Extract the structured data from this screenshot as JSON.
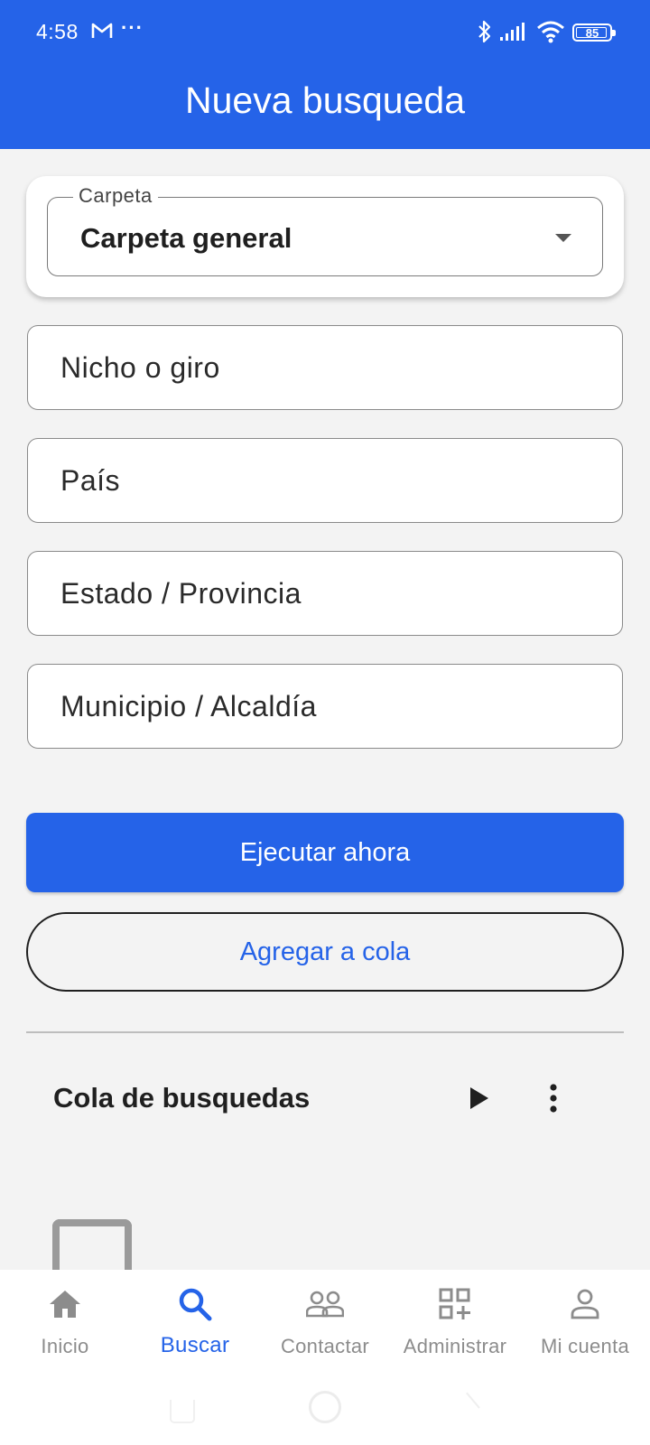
{
  "status_bar": {
    "time": "4:58",
    "battery": "85"
  },
  "header": {
    "title": "Nueva busqueda"
  },
  "colors": {
    "primary": "#2563e8",
    "background": "#f3f3f3"
  },
  "folder_select": {
    "label": "Carpeta",
    "value": "Carpeta general"
  },
  "fields": {
    "niche": {
      "placeholder": "Nicho o giro"
    },
    "country": {
      "placeholder": "País"
    },
    "state": {
      "placeholder": "Estado / Provincia"
    },
    "municipality": {
      "placeholder": "Municipio / Alcaldía"
    }
  },
  "actions": {
    "run_now": "Ejecutar ahora",
    "add_to_queue": "Agregar a cola"
  },
  "queue": {
    "title": "Cola de busquedas"
  },
  "bottom_nav": {
    "items": [
      {
        "label": "Inicio",
        "icon": "home-icon"
      },
      {
        "label": "Buscar",
        "icon": "search-icon",
        "active": true
      },
      {
        "label": "Contactar",
        "icon": "people-icon"
      },
      {
        "label": "Administrar",
        "icon": "grid-add-icon"
      },
      {
        "label": "Mi cuenta",
        "icon": "person-icon"
      }
    ]
  }
}
